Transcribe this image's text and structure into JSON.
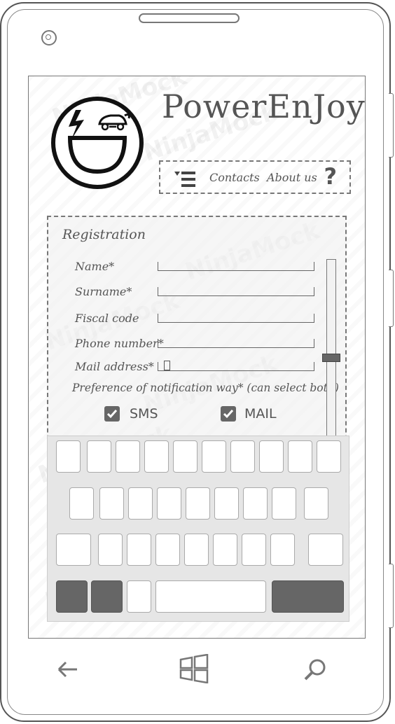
{
  "app": {
    "title": "PowerEnJoy"
  },
  "nav": {
    "menu_icon": "menu-icon",
    "contacts_label": "Contacts",
    "about_label": "About us",
    "help_label": "?"
  },
  "registration": {
    "title": "Registration",
    "fields": [
      {
        "label": "Name*",
        "value": ""
      },
      {
        "label": "Surname*",
        "value": ""
      },
      {
        "label": "Fiscal code",
        "value": ""
      },
      {
        "label": "Phone number*",
        "value": ""
      },
      {
        "label": "Mail address*",
        "value": ""
      }
    ],
    "preference_label": "Preference of notification way* (can select both)",
    "options": [
      {
        "label": "SMS",
        "checked": true
      },
      {
        "label": "MAIL",
        "checked": true
      }
    ]
  },
  "watermark": "NinjaMock",
  "hardware": {
    "back": "back-arrow-icon",
    "start": "windows-start-icon",
    "search": "search-icon"
  },
  "colors": {
    "ink": "#555555",
    "dark_key": "#666666",
    "keyboard_bg": "#e6e6e6"
  }
}
